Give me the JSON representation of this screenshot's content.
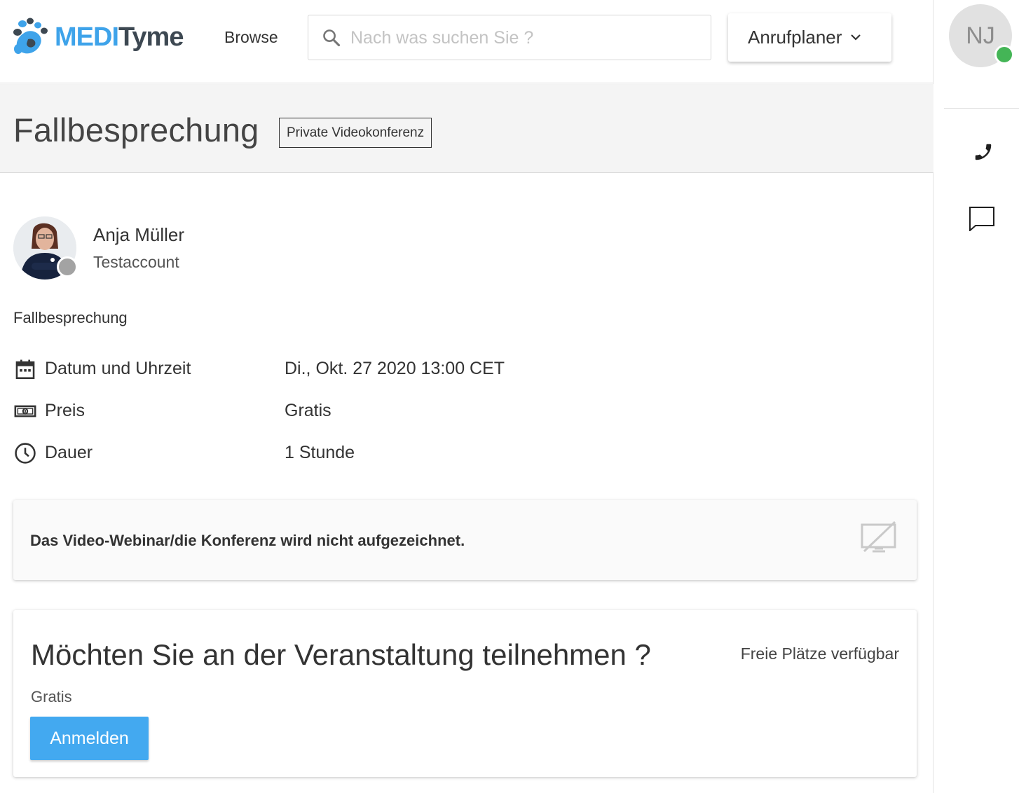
{
  "header": {
    "logo": {
      "part1": "MEDI",
      "part2": "Tyme",
      "icon": "paw-logo-icon"
    },
    "browse_label": "Browse",
    "search": {
      "placeholder": "Nach was suchen Sie ?",
      "value": "",
      "icon": "search-icon"
    },
    "planner": {
      "label": "Anrufplaner",
      "icon": "chevron-down-icon"
    }
  },
  "rail": {
    "user_initials": "NJ",
    "user_status_color": "#44b556",
    "icons": [
      "phone-icon",
      "chat-icon"
    ]
  },
  "title_band": {
    "title": "Fallbesprechung",
    "badge": "Private Videokonferenz"
  },
  "host": {
    "name": "Anja Müller",
    "role": "Testaccount",
    "status_color": "#a3a3a3"
  },
  "description": "Fallbesprechung",
  "details": [
    {
      "icon": "calendar-icon",
      "label": "Datum und Uhrzeit",
      "value": "Di., Okt. 27 2020 13:00 CET"
    },
    {
      "icon": "money-icon",
      "label": "Preis",
      "value": "Gratis"
    },
    {
      "icon": "clock-icon",
      "label": "Dauer",
      "value": "1 Stunde"
    }
  ],
  "notice": {
    "text": "Das Video-Webinar/die Konferenz wird nicht aufgezeichnet.",
    "icon": "no-recording-icon"
  },
  "join": {
    "title": "Möchten Sie an der Veranstaltung teilnehmen ?",
    "seats": "Freie Plätze verfügbar",
    "price": "Gratis",
    "button": "Anmelden"
  },
  "colors": {
    "accent": "#43a9f0",
    "logo_blue": "#3ea3ea",
    "logo_dark": "#3d4852",
    "band_bg": "#f4f4f4"
  }
}
